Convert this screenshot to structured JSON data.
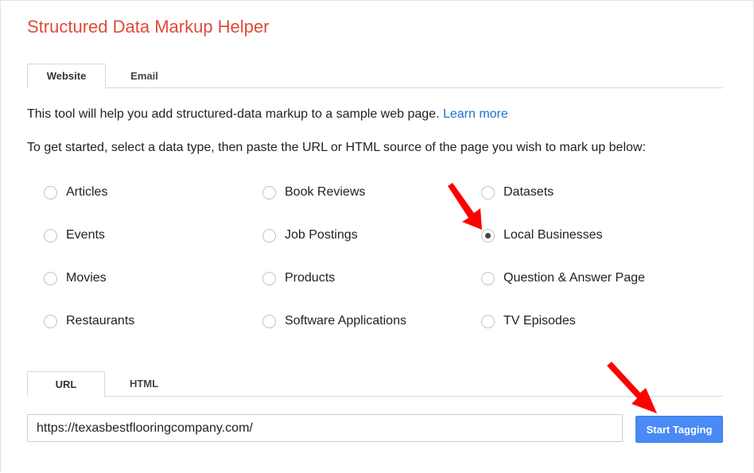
{
  "title": "Structured Data Markup Helper",
  "source_tabs": [
    {
      "label": "Website",
      "active": true
    },
    {
      "label": "Email",
      "active": false
    }
  ],
  "intro": {
    "text": "This tool will help you add structured-data markup to a sample web page. ",
    "link_text": "Learn more"
  },
  "instructions": "To get started, select a data type, then paste the URL or HTML source of the page you wish to mark up below:",
  "data_types": [
    {
      "label": "Articles",
      "checked": false
    },
    {
      "label": "Book Reviews",
      "checked": false
    },
    {
      "label": "Datasets",
      "checked": false
    },
    {
      "label": "Events",
      "checked": false
    },
    {
      "label": "Job Postings",
      "checked": false
    },
    {
      "label": "Local Businesses",
      "checked": true
    },
    {
      "label": "Movies",
      "checked": false
    },
    {
      "label": "Products",
      "checked": false
    },
    {
      "label": "Question & Answer Page",
      "checked": false
    },
    {
      "label": "Restaurants",
      "checked": false
    },
    {
      "label": "Software Applications",
      "checked": false
    },
    {
      "label": "TV Episodes",
      "checked": false
    }
  ],
  "input_tabs": [
    {
      "label": "URL",
      "active": true
    },
    {
      "label": "HTML",
      "active": false
    }
  ],
  "url_input": {
    "value": "https://texasbestflooringcompany.com/"
  },
  "start_button": {
    "label": "Start Tagging"
  },
  "colors": {
    "title": "#dd4b39",
    "link": "#1a73c8",
    "button": "#4a8af4",
    "annotation_arrow": "#ff0000"
  },
  "annotations": [
    {
      "icon": "red-arrow-icon",
      "points_to": "Local Businesses"
    },
    {
      "icon": "red-arrow-icon",
      "points_to": "Start Tagging"
    }
  ]
}
